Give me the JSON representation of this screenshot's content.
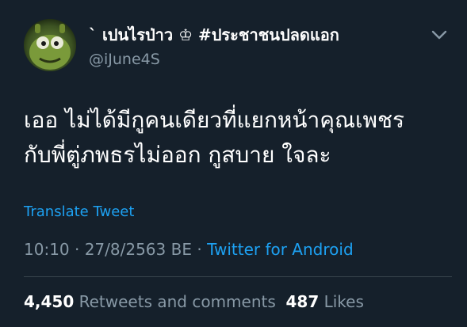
{
  "tweet": {
    "author": {
      "display_name": "` เปนไรป่าว ♔ #ประชาชนปลดแอก",
      "handle": "@iJune4S",
      "avatar_icon": "green-monster-avatar-icon"
    },
    "menu_icon": "chevron-down-icon",
    "text_lines": [
      "เออ ไม่ได้มีกูคนเดียวที่แยกหน้าคุณเพชร",
      "กับพี่ตู่ภพธรไม่ออก กูสบาย ใจละ"
    ],
    "translate_label": "Translate Tweet",
    "timestamp": "10:10 · 27/8/2563 BE",
    "separator": " · ",
    "source": "Twitter for Android",
    "retweets_count": "4,450",
    "retweets_label": "Retweets and comments",
    "likes_count": "487",
    "likes_label": "Likes"
  },
  "colors": {
    "background": "#15202b",
    "text": "#ffffff",
    "muted": "#8899a6",
    "link": "#1da1f2",
    "divider": "#38444d"
  }
}
